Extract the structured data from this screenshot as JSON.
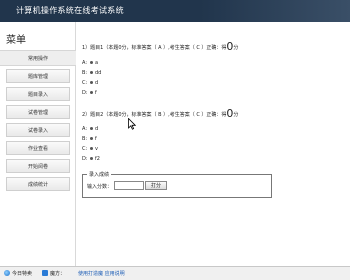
{
  "header": {
    "title": "计算机操作系统在线考试系统"
  },
  "sidebar": {
    "title": "菜单",
    "items": [
      {
        "label": "常用操作"
      },
      {
        "label": "题库管理"
      },
      {
        "label": "题目录入"
      },
      {
        "label": "试卷管理"
      },
      {
        "label": "试卷录入"
      },
      {
        "label": "作业查看"
      },
      {
        "label": "开始阅卷"
      },
      {
        "label": "成绩统计"
      }
    ]
  },
  "questions": [
    {
      "head": "1）题目1（本题0分，标准答案（ A ）,考生答案（ C ）正确：得",
      "score": "0",
      "unit": "分",
      "options": [
        {
          "key": "A:",
          "text": "a"
        },
        {
          "key": "B:",
          "text": "dd"
        },
        {
          "key": "C:",
          "text": "d"
        },
        {
          "key": "D:",
          "text": "f"
        }
      ]
    },
    {
      "head": "2）题目2（本题0分，标准答案（ B ）,考生答案（ C ）正确：得",
      "score": "0",
      "unit": "分",
      "options": [
        {
          "key": "A:",
          "text": "d"
        },
        {
          "key": "B:",
          "text": "f"
        },
        {
          "key": "C:",
          "text": "v"
        },
        {
          "key": "D:",
          "text": "f2"
        }
      ]
    }
  ],
  "grade": {
    "legend": "录入成绩",
    "label": "输入分数：",
    "input_value": "",
    "button": "打分"
  },
  "statusbar": {
    "item1": "今日特卖",
    "item2": "魔方：",
    "link": "使用打造魔 应用说明"
  }
}
